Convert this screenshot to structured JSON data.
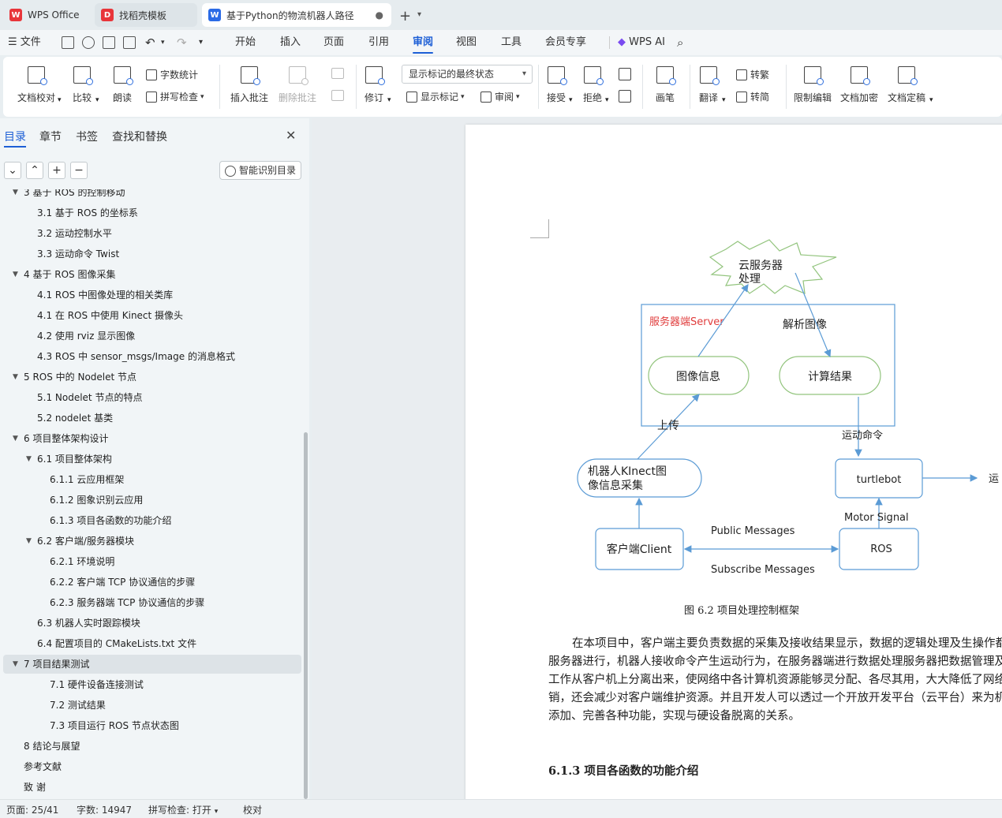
{
  "tabs": [
    {
      "label": "WPS Office",
      "icon": "wps-logo-icon"
    },
    {
      "label": "找稻壳模板",
      "icon": "docer-icon"
    },
    {
      "label": "基于Python的物流机器人路径",
      "icon": "writer-doc-icon"
    }
  ],
  "menu": {
    "file": "文件",
    "items": [
      "开始",
      "插入",
      "页面",
      "引用",
      "审阅",
      "视图",
      "工具",
      "会员专享"
    ],
    "active": "审阅",
    "ai": "WPS AI"
  },
  "ribbon": {
    "doc_check": "文档校对",
    "compare": "比较",
    "read_aloud": "朗读",
    "word_count": "字数统计",
    "spell_check": "拼写检查",
    "insert_comment": "插入批注",
    "delete_comment": "删除批注",
    "track": "修订",
    "markup_state": "显示标记的最终状态",
    "show_markup": "显示标记",
    "review": "审阅",
    "accept": "接受",
    "reject": "拒绝",
    "pen": "画笔",
    "translate": "翻译",
    "to_traditional": "转繁",
    "to_simplified": "转简",
    "restrict_edit": "限制编辑",
    "encrypt": "文档加密",
    "finalize": "文档定稿"
  },
  "sidebar": {
    "tabs": [
      "目录",
      "章节",
      "书签",
      "查找和替换"
    ],
    "smart_toc": "智能识别目录",
    "toc": [
      {
        "label": "3   基于 ROS 的控制移动",
        "level": 1,
        "expanded": true
      },
      {
        "label": "3.1  基于 ROS 的坐标系",
        "level": 2
      },
      {
        "label": "3.2  运动控制水平",
        "level": 2
      },
      {
        "label": "3.3 运动命令 Twist",
        "level": 2
      },
      {
        "label": "4    基于 ROS 图像采集",
        "level": 1,
        "expanded": true
      },
      {
        "label": "4.1 ROS 中图像处理的相关类库",
        "level": 2
      },
      {
        "label": "4.1  在 ROS 中使用 Kinect 摄像头",
        "level": 2
      },
      {
        "label": "4.2  使用 rviz 显示图像",
        "level": 2
      },
      {
        "label": "4.3 ROS 中 sensor_msgs/Image 的消息格式",
        "level": 2
      },
      {
        "label": "5    ROS 中的 Nodelet 节点",
        "level": 1,
        "expanded": true
      },
      {
        "label": "5.1 Nodelet 节点的特点",
        "level": 2
      },
      {
        "label": "5.2 nodelet 基类",
        "level": 2
      },
      {
        "label": "6    项目整体架构设计",
        "level": 1,
        "expanded": true
      },
      {
        "label": "6.1  项目整体架构",
        "level": 2,
        "expanded": true
      },
      {
        "label": "6.1.1  云应用框架",
        "level": 3
      },
      {
        "label": "6.1.2  图象识别云应用",
        "level": 3
      },
      {
        "label": "6.1.3  项目各函数的功能介绍",
        "level": 3
      },
      {
        "label": "6.2  客户端/服务器模块",
        "level": 2,
        "expanded": true
      },
      {
        "label": "6.2.1 环境说明",
        "level": 3
      },
      {
        "label": "6.2.2 客户端 TCP 协议通信的步骤",
        "level": 3
      },
      {
        "label": "6.2.3 服务器端 TCP 协议通信的步骤",
        "level": 3
      },
      {
        "label": "6.3  机器人实时跟踪模块",
        "level": 2
      },
      {
        "label": "6.4  配置项目的 CMakeLists.txt 文件",
        "level": 2
      },
      {
        "label": "7    项目结果测试",
        "level": 1,
        "expanded": true,
        "selected": true
      },
      {
        "label": "7.1 硬件设备连接测试",
        "level": 3
      },
      {
        "label": "7.2 测试结果",
        "level": 3
      },
      {
        "label": "7.3 项目运行 ROS 节点状态图",
        "level": 3
      },
      {
        "label": "8    结论与展望",
        "level": 1
      },
      {
        "label": "参考文献",
        "level": 1
      },
      {
        "label": "致  谢",
        "level": 1
      }
    ]
  },
  "diagram": {
    "cloud": [
      "云服务器",
      "处理"
    ],
    "server_label": "服务器端Server",
    "parse_image": "解析图像",
    "image_info": "图像信息",
    "compute_result": "计算结果",
    "upload": "上传",
    "motion_cmd": "运动命令",
    "robot_capture": [
      "机器人KInect图",
      "像信息采集"
    ],
    "turtlebot": "turtlebot",
    "edge_text": "运",
    "motor_signal": "Motor  Signal",
    "client": "客户端Client",
    "public_msgs": "Public Messages",
    "subscribe_msgs": "Subscribe Messages",
    "ros": "ROS",
    "colors": {
      "accent": "#5b9bd5",
      "node_border": "#92c47d",
      "server_text": "#e03c3c"
    }
  },
  "document": {
    "caption": "图 6.2 项目处理控制框架",
    "paragraph": "在本项目中，客户端主要负责数据的采集及接收结果显示，数据的逻辑处理及生操作都放在服务器进行，机器人接收命令产生运动行为，在服务器端进行数据处理服务器把数据管理及处理工作从客户机上分离出来，使网络中各计算机资源能够灵分配、各尽其用，大大降低了网络开销，还会减少对客户端维护资源。并且开发人可以透过一个开放开发平台（云平台）来为机器人添加、完善各种功能，实现与硬设备脱离的关系。",
    "heading": "6.1.3  项目各函数的功能介绍"
  },
  "status": {
    "page": "页面: 25/41",
    "words": "字数: 14947",
    "spell": "拼写检查: 打开",
    "proof": "校对"
  }
}
